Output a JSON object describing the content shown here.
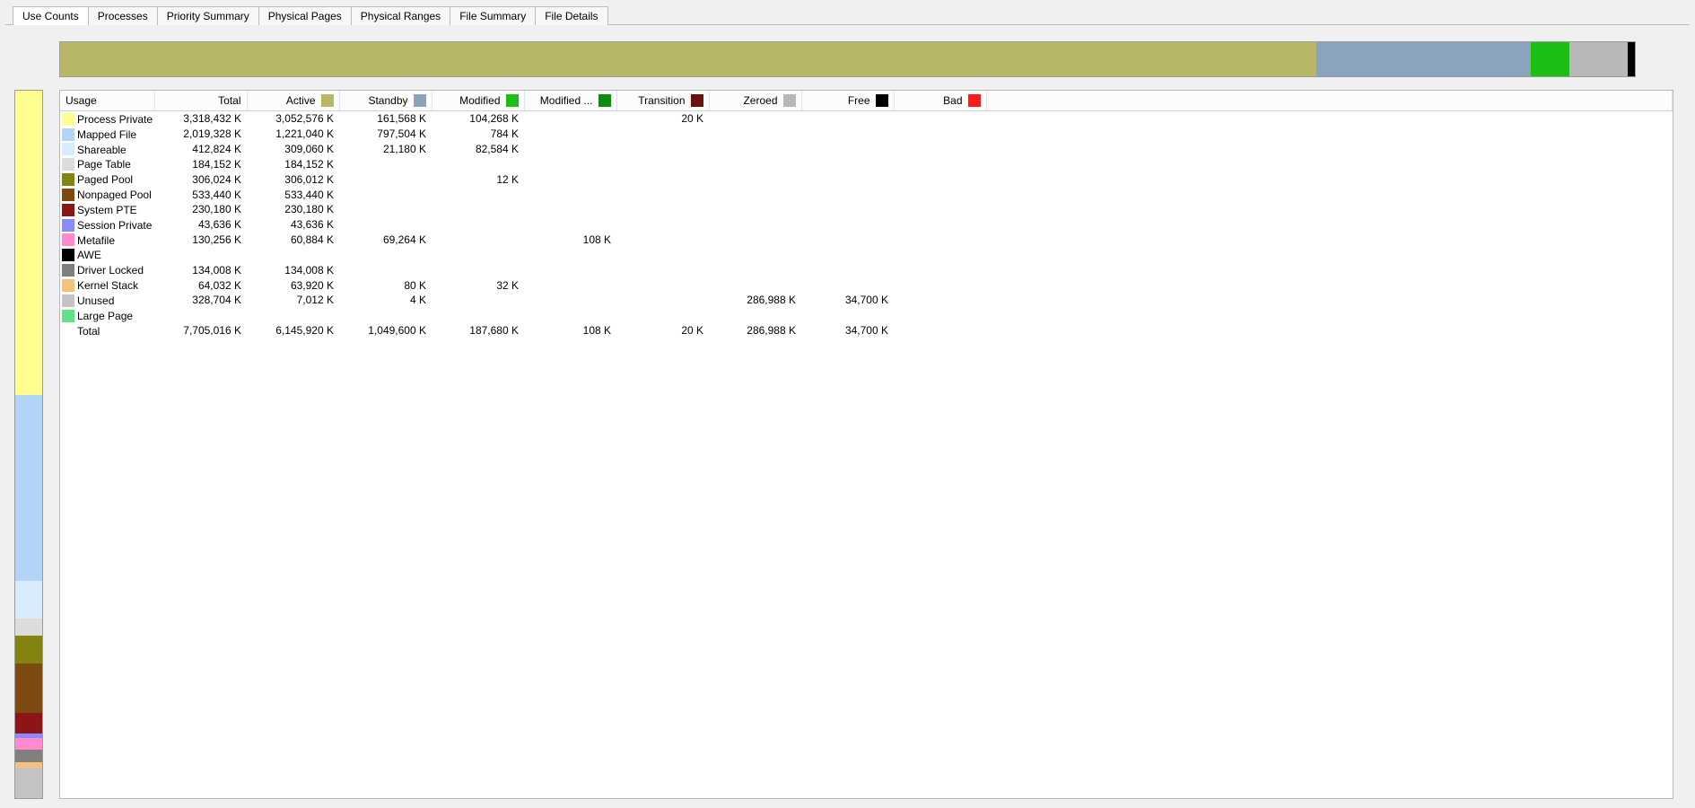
{
  "tabs": [
    {
      "label": "Use Counts",
      "active": true
    },
    {
      "label": "Processes",
      "active": false
    },
    {
      "label": "Priority Summary",
      "active": false
    },
    {
      "label": "Physical Pages",
      "active": false
    },
    {
      "label": "Physical Ranges",
      "active": false
    },
    {
      "label": "File Summary",
      "active": false
    },
    {
      "label": "File Details",
      "active": false
    }
  ],
  "top_bar": [
    {
      "color": "#b8b765",
      "flex": 6146
    },
    {
      "color": "#8ba4bd",
      "flex": 1050
    },
    {
      "color": "#1cc014",
      "flex": 188
    },
    {
      "color": "#b8b8b8",
      "flex": 287
    },
    {
      "color": "#000000",
      "flex": 35
    }
  ],
  "left_bar": [
    {
      "color": "#ffff8f",
      "flex": 3318
    },
    {
      "color": "#b2d4f7",
      "flex": 2019
    },
    {
      "color": "#d9ecff",
      "flex": 413
    },
    {
      "color": "#dcdcdc",
      "flex": 184
    },
    {
      "color": "#838310",
      "flex": 306
    },
    {
      "color": "#7e4a12",
      "flex": 533
    },
    {
      "color": "#8e1515",
      "flex": 230
    },
    {
      "color": "#8a8aff",
      "flex": 44
    },
    {
      "color": "#ff8ad0",
      "flex": 130
    },
    {
      "color": "#808080",
      "flex": 134
    },
    {
      "color": "#f7c17a",
      "flex": 64
    },
    {
      "color": "#c4c4c4",
      "flex": 329
    }
  ],
  "columns": [
    {
      "key": "usage",
      "label": "Usage",
      "swatch": null,
      "align": "left"
    },
    {
      "key": "total",
      "label": "Total",
      "swatch": null,
      "align": "right"
    },
    {
      "key": "active",
      "label": "Active",
      "swatch": "#b8b765",
      "align": "right"
    },
    {
      "key": "standby",
      "label": "Standby",
      "swatch": "#8ba4bd",
      "align": "right"
    },
    {
      "key": "modified",
      "label": "Modified",
      "swatch": "#1cc014",
      "align": "right"
    },
    {
      "key": "modified_nw",
      "label": "Modified ...",
      "swatch": "#0b8f0b",
      "align": "right"
    },
    {
      "key": "transition",
      "label": "Transition",
      "swatch": "#6b0f0f",
      "align": "right"
    },
    {
      "key": "zeroed",
      "label": "Zeroed",
      "swatch": "#b8b8b8",
      "align": "right"
    },
    {
      "key": "free",
      "label": "Free",
      "swatch": "#000000",
      "align": "right"
    },
    {
      "key": "bad",
      "label": "Bad",
      "swatch": "#ff1a1a",
      "align": "right"
    }
  ],
  "rows": [
    {
      "swatch": "#ffff8f",
      "usage": "Process Private",
      "total": "3,318,432 K",
      "active": "3,052,576 K",
      "standby": "161,568 K",
      "modified": "104,268 K",
      "modified_nw": "",
      "transition": "20 K",
      "zeroed": "",
      "free": "",
      "bad": ""
    },
    {
      "swatch": "#b2d4f7",
      "usage": "Mapped File",
      "total": "2,019,328 K",
      "active": "1,221,040 K",
      "standby": "797,504 K",
      "modified": "784 K",
      "modified_nw": "",
      "transition": "",
      "zeroed": "",
      "free": "",
      "bad": ""
    },
    {
      "swatch": "#d9ecff",
      "usage": "Shareable",
      "total": "412,824 K",
      "active": "309,060 K",
      "standby": "21,180 K",
      "modified": "82,584 K",
      "modified_nw": "",
      "transition": "",
      "zeroed": "",
      "free": "",
      "bad": ""
    },
    {
      "swatch": "#dcdcdc",
      "usage": "Page Table",
      "total": "184,152 K",
      "active": "184,152 K",
      "standby": "",
      "modified": "",
      "modified_nw": "",
      "transition": "",
      "zeroed": "",
      "free": "",
      "bad": ""
    },
    {
      "swatch": "#838310",
      "usage": "Paged Pool",
      "total": "306,024 K",
      "active": "306,012 K",
      "standby": "",
      "modified": "12 K",
      "modified_nw": "",
      "transition": "",
      "zeroed": "",
      "free": "",
      "bad": ""
    },
    {
      "swatch": "#7e4a12",
      "usage": "Nonpaged Pool",
      "total": "533,440 K",
      "active": "533,440 K",
      "standby": "",
      "modified": "",
      "modified_nw": "",
      "transition": "",
      "zeroed": "",
      "free": "",
      "bad": ""
    },
    {
      "swatch": "#8e1515",
      "usage": "System PTE",
      "total": "230,180 K",
      "active": "230,180 K",
      "standby": "",
      "modified": "",
      "modified_nw": "",
      "transition": "",
      "zeroed": "",
      "free": "",
      "bad": ""
    },
    {
      "swatch": "#8a8aff",
      "usage": "Session Private",
      "total": "43,636 K",
      "active": "43,636 K",
      "standby": "",
      "modified": "",
      "modified_nw": "",
      "transition": "",
      "zeroed": "",
      "free": "",
      "bad": ""
    },
    {
      "swatch": "#ff8ad0",
      "usage": "Metafile",
      "total": "130,256 K",
      "active": "60,884 K",
      "standby": "69,264 K",
      "modified": "",
      "modified_nw": "108 K",
      "transition": "",
      "zeroed": "",
      "free": "",
      "bad": ""
    },
    {
      "swatch": "#000000",
      "usage": "AWE",
      "total": "",
      "active": "",
      "standby": "",
      "modified": "",
      "modified_nw": "",
      "transition": "",
      "zeroed": "",
      "free": "",
      "bad": ""
    },
    {
      "swatch": "#808080",
      "usage": "Driver Locked",
      "total": "134,008 K",
      "active": "134,008 K",
      "standby": "",
      "modified": "",
      "modified_nw": "",
      "transition": "",
      "zeroed": "",
      "free": "",
      "bad": ""
    },
    {
      "swatch": "#f7c17a",
      "usage": "Kernel Stack",
      "total": "64,032 K",
      "active": "63,920 K",
      "standby": "80 K",
      "modified": "32 K",
      "modified_nw": "",
      "transition": "",
      "zeroed": "",
      "free": "",
      "bad": ""
    },
    {
      "swatch": "#c4c4c4",
      "usage": "Unused",
      "total": "328,704 K",
      "active": "7,012 K",
      "standby": "4 K",
      "modified": "",
      "modified_nw": "",
      "transition": "",
      "zeroed": "286,988 K",
      "free": "34,700 K",
      "bad": ""
    },
    {
      "swatch": "#5fe28a",
      "usage": "Large Page",
      "total": "",
      "active": "",
      "standby": "",
      "modified": "",
      "modified_nw": "",
      "transition": "",
      "zeroed": "",
      "free": "",
      "bad": ""
    }
  ],
  "totals": {
    "usage": "Total",
    "total": "7,705,016 K",
    "active": "6,145,920 K",
    "standby": "1,049,600 K",
    "modified": "187,680 K",
    "modified_nw": "108 K",
    "transition": "20 K",
    "zeroed": "286,988 K",
    "free": "34,700 K",
    "bad": ""
  },
  "chart_data": [
    {
      "type": "bar",
      "title": "Physical memory by state (horizontal stacked bar)",
      "categories": [
        "Active",
        "Standby",
        "Modified",
        "Zeroed",
        "Free"
      ],
      "values": [
        6145920,
        1049600,
        187680,
        286988,
        34700
      ],
      "unit": "K",
      "xlabel": "",
      "ylabel": "",
      "colors": [
        "#b8b765",
        "#8ba4bd",
        "#1cc014",
        "#b8b8b8",
        "#000000"
      ]
    },
    {
      "type": "bar",
      "title": "Physical memory by usage (vertical stacked bar)",
      "categories": [
        "Process Private",
        "Mapped File",
        "Shareable",
        "Page Table",
        "Paged Pool",
        "Nonpaged Pool",
        "System PTE",
        "Session Private",
        "Metafile",
        "AWE",
        "Driver Locked",
        "Kernel Stack",
        "Unused",
        "Large Page"
      ],
      "values": [
        3318432,
        2019328,
        412824,
        184152,
        306024,
        533440,
        230180,
        43636,
        130256,
        0,
        134008,
        64032,
        328704,
        0
      ],
      "unit": "K",
      "xlabel": "",
      "ylabel": "",
      "colors": [
        "#ffff8f",
        "#b2d4f7",
        "#d9ecff",
        "#dcdcdc",
        "#838310",
        "#7e4a12",
        "#8e1515",
        "#8a8aff",
        "#ff8ad0",
        "#000000",
        "#808080",
        "#f7c17a",
        "#c4c4c4",
        "#5fe28a"
      ]
    }
  ]
}
